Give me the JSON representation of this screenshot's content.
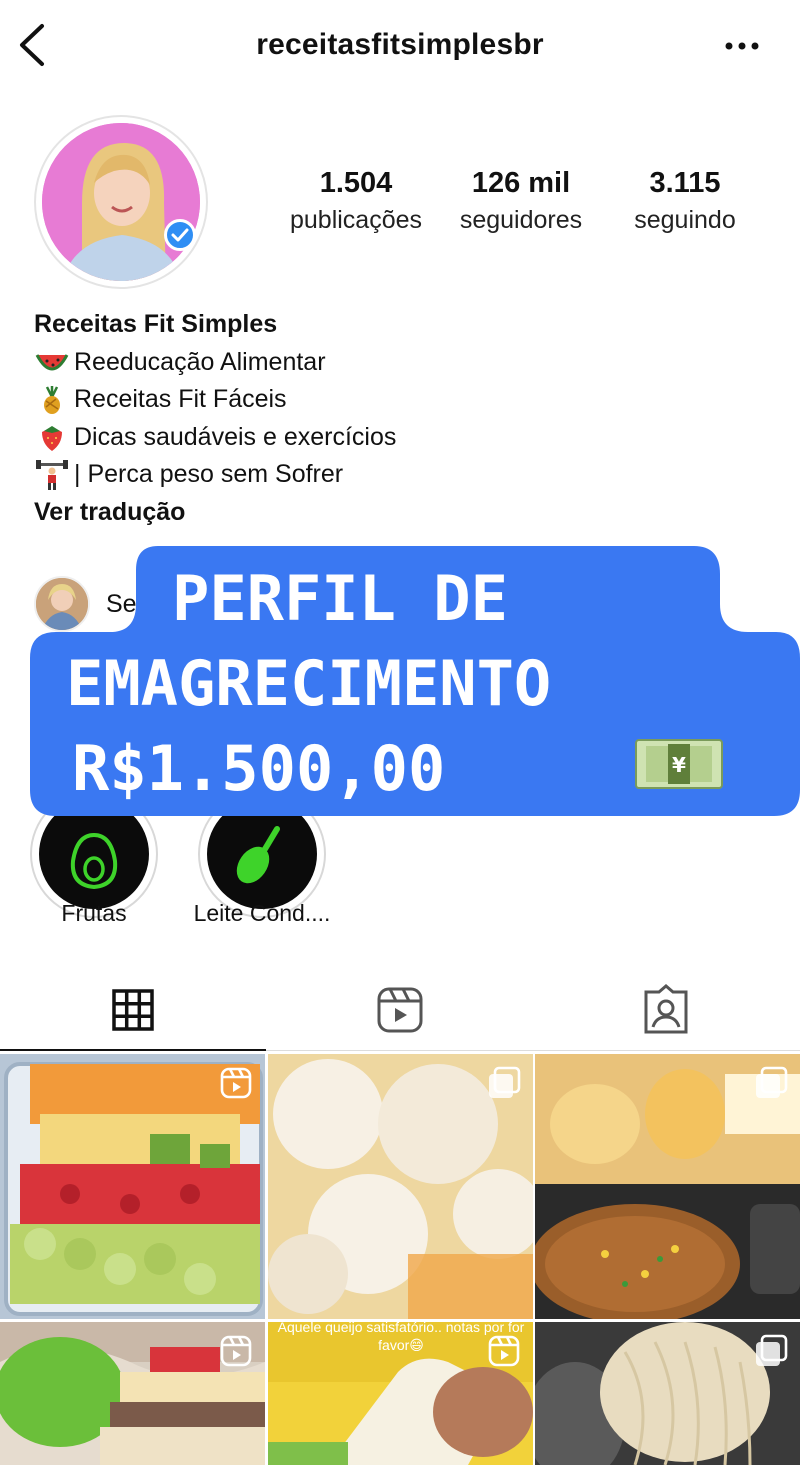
{
  "header": {
    "username": "receitasfitsimplesbr"
  },
  "profile": {
    "stats": [
      {
        "value": "1.504",
        "label": "publicações"
      },
      {
        "value": "126 mil",
        "label": "seguidores"
      },
      {
        "value": "3.115",
        "label": "seguindo"
      }
    ],
    "display_name": "Receitas Fit Simples",
    "bio_lines": [
      {
        "emoji": "watermelon-icon",
        "text": "Reeducação Alimentar"
      },
      {
        "emoji": "pineapple-icon",
        "text": "Receitas Fit Fáceis"
      },
      {
        "emoji": "strawberry-icon",
        "text": "Dicas saudáveis e exercícios"
      },
      {
        "emoji": "weightlifter-icon",
        "text": "| Perca peso sem Sofrer"
      }
    ],
    "see_translation": "Ver tradução",
    "followed_by_fragment": "Se"
  },
  "overlay": {
    "lines": [
      "PERFIL DE",
      "EMAGRECIMENTO",
      "R$1.500,00"
    ],
    "emoji": "money-banknote-icon",
    "color": "#3a78f2"
  },
  "highlights": [
    {
      "label": "Frutas",
      "icon": "avocado-icon"
    },
    {
      "label": "Leite Cond....",
      "icon": "spoon-icon"
    }
  ],
  "tabs": [
    {
      "name": "grid-tab",
      "icon": "grid-icon",
      "active": true
    },
    {
      "name": "reels-tab",
      "icon": "reels-icon",
      "active": false
    },
    {
      "name": "tagged-tab",
      "icon": "tagged-icon",
      "active": false
    }
  ],
  "posts": [
    {
      "subject": "fruit salad",
      "badge": "reels-icon"
    },
    {
      "subject": "cheese balls",
      "badge": "carousel-icon"
    },
    {
      "subject": "bread rolls and ground meat",
      "badge": "carousel-icon"
    },
    {
      "subject": "sandwich",
      "badge": "reels-icon"
    },
    {
      "subject": "cheese",
      "badge": "reels-icon",
      "caption": "Aquele queijo satisfatório.. notas por for favor😄"
    },
    {
      "subject": "pasta",
      "badge": "carousel-icon"
    }
  ],
  "colors": {
    "accent_green": "#3ed32a",
    "verified_blue": "#2f8ef4",
    "avatar_pink": "#e77bd4"
  }
}
